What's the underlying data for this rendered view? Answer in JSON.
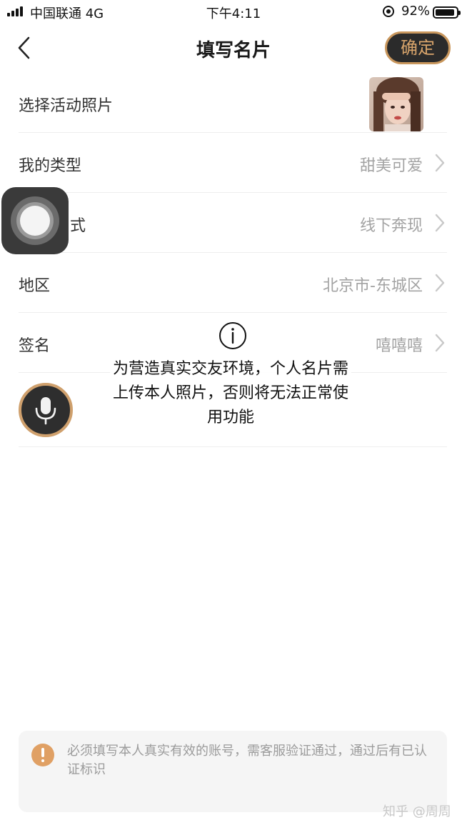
{
  "status_bar": {
    "carrier": "中国联通  4G",
    "time": "下午4:11",
    "battery_percent": "92%",
    "battery_level": 0.92,
    "signal_bars": 4
  },
  "nav": {
    "title": "填写名片",
    "confirm_label": "确定",
    "back_icon": "chevron-left-icon"
  },
  "form": {
    "photo": {
      "label": "选择活动照片"
    },
    "type": {
      "label": "我的类型",
      "value": "甜美可爱"
    },
    "method": {
      "label": "式",
      "value": "线下奔现"
    },
    "region": {
      "label": "地区",
      "value": "北京市-东城区"
    },
    "signature": {
      "label": "签名",
      "value": "嘻嘻嘻"
    }
  },
  "toast": {
    "icon": "info-icon",
    "message": "为营造真实交友环境，个人名片需上传本人照片，否则将无法正常使用功能"
  },
  "notice": {
    "icon": "warning-icon",
    "text": "必须填写本人真实有效的账号，需客服验证通过，通过后有已认证标识"
  },
  "watermark": "知乎 @周周",
  "colors": {
    "accent_gold": "#c9975d",
    "button_dark": "#2b2b2b",
    "value_gray": "#a3a3a3",
    "warning_orange": "#e0a064"
  }
}
